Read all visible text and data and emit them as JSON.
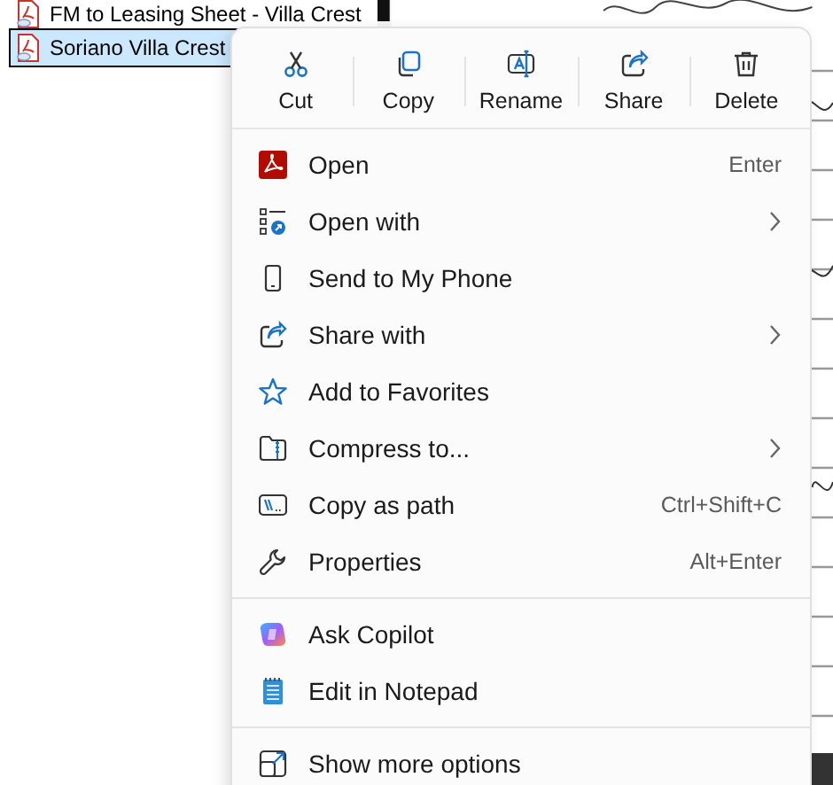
{
  "files": [
    {
      "name": "FM to Leasing Sheet - Villa Crest",
      "selected": false
    },
    {
      "name": "Soriano Villa Crest",
      "selected": true
    }
  ],
  "context_menu": {
    "actions": [
      {
        "label": "Cut"
      },
      {
        "label": "Copy"
      },
      {
        "label": "Rename"
      },
      {
        "label": "Share"
      },
      {
        "label": "Delete"
      }
    ],
    "sections": [
      [
        {
          "label": "Open",
          "shortcut": "Enter",
          "submenu": false
        },
        {
          "label": "Open with",
          "submenu": true
        },
        {
          "label": "Send to My Phone",
          "submenu": false
        },
        {
          "label": "Share with",
          "submenu": true
        },
        {
          "label": "Add to Favorites",
          "submenu": false
        },
        {
          "label": "Compress to...",
          "submenu": true
        },
        {
          "label": "Copy as path",
          "shortcut": "Ctrl+Shift+C",
          "submenu": false
        },
        {
          "label": "Properties",
          "shortcut": "Alt+Enter",
          "submenu": false
        }
      ],
      [
        {
          "label": "Ask Copilot",
          "submenu": false
        },
        {
          "label": "Edit in Notepad",
          "submenu": false
        }
      ],
      [
        {
          "label": "Show more options",
          "submenu": false
        }
      ]
    ]
  }
}
